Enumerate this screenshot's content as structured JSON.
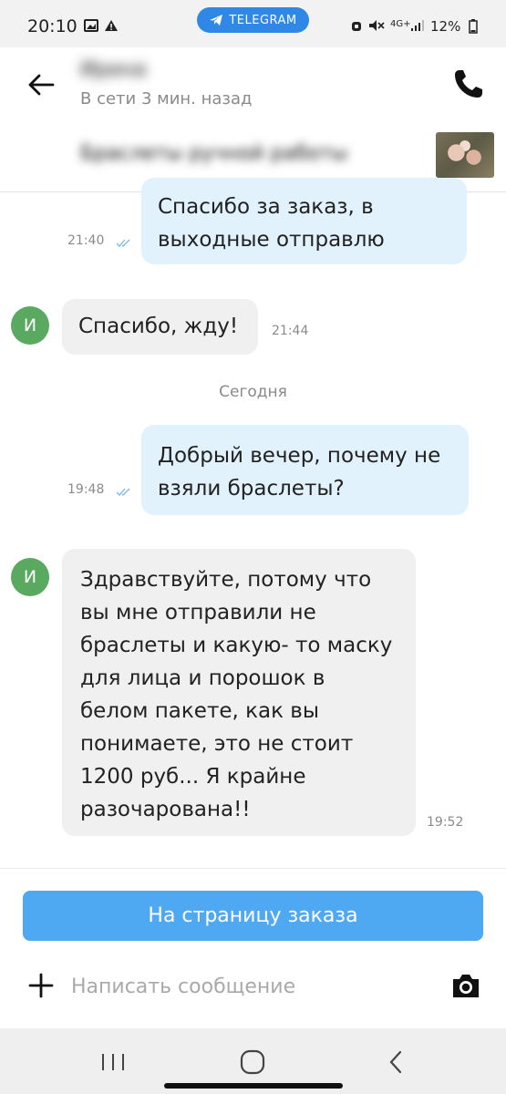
{
  "status_bar": {
    "time": "20:10",
    "telegram_label": "TELEGRAM",
    "network": "4G+",
    "battery": "12%"
  },
  "header": {
    "contact_name": "Ирина",
    "contact_status": "В сети 3 мин. назад"
  },
  "order": {
    "title": "Браслеты ручной работы"
  },
  "messages": [
    {
      "direction": "out",
      "text_lines": [
        "Спасибо за заказ,  в",
        "выходные отправлю"
      ],
      "time": "21:40",
      "read": true
    },
    {
      "direction": "in",
      "avatar": "И",
      "text_lines": [
        "Спасибо, жду!"
      ],
      "time": "21:44"
    },
    {
      "direction": "out",
      "text_lines": [
        "Добрый вечер, почему не",
        "взяли браслеты?"
      ],
      "time": "19:48",
      "read": true
    },
    {
      "direction": "in",
      "avatar": "И",
      "text_lines": [
        "Здравствуйте, потому что",
        "вы мне отправили не",
        "браслеты и какую- то маску",
        "для лица и порошок в",
        "белом пакете, как вы",
        "понимаете, это не стоит",
        "1200 руб... Я крайне",
        "разочарована!!"
      ],
      "time": "19:52"
    }
  ],
  "day_separator": "Сегодня",
  "order_button_label": "На страницу заказа",
  "composer": {
    "placeholder": "Написать сообщение",
    "value": ""
  },
  "colors": {
    "accent": "#4ea8f2",
    "telegram": "#2f88e6",
    "outgoing_bubble": "#e2f2fd",
    "incoming_bubble": "#f0f0f0",
    "avatar": "#5aa960"
  }
}
